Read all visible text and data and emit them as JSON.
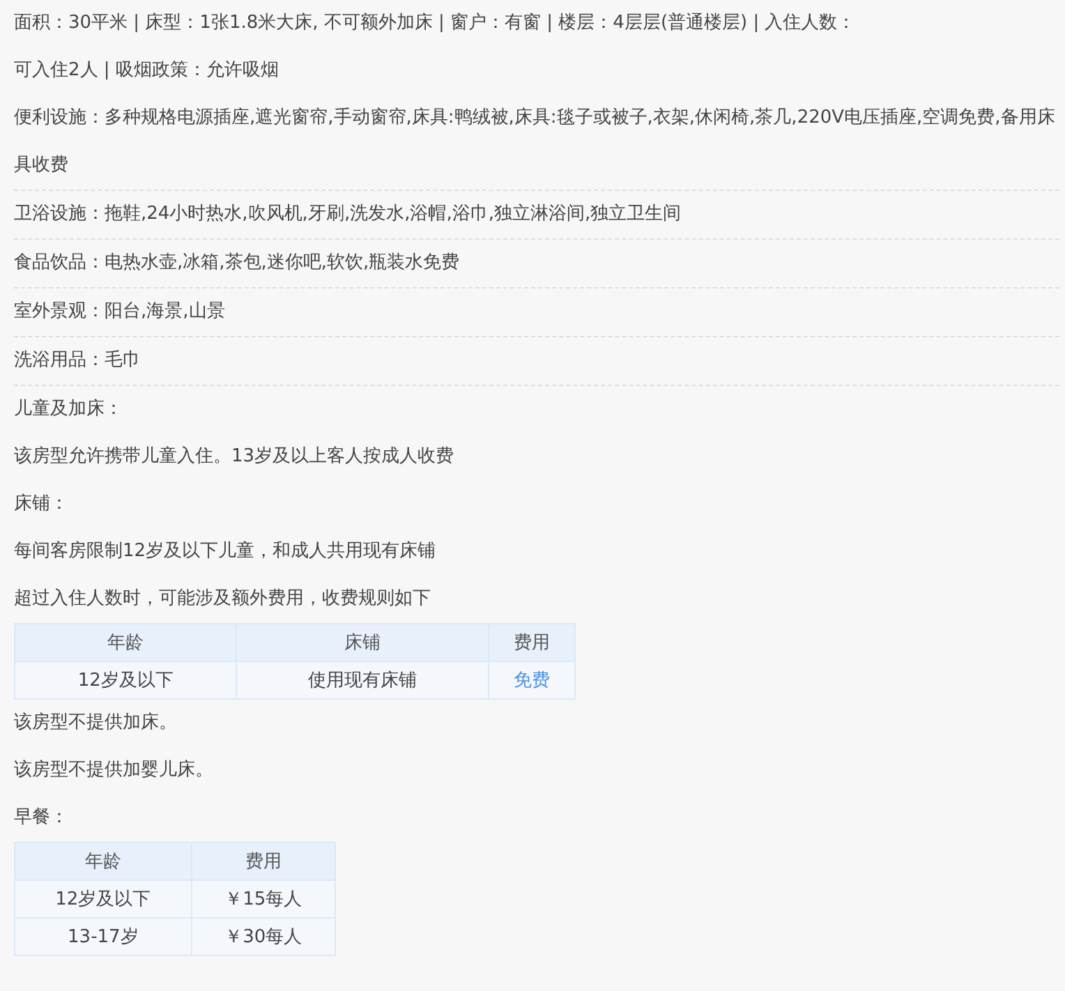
{
  "blocks": [
    {
      "kind": "text",
      "text": "面积：30平米 | 床型：1张1.8米大床, 不可额外加床 | 窗户：有窗 | 楼层：4层层(普通楼层) | 入住人数：",
      "divider": false
    },
    {
      "kind": "text",
      "text": "可入住2人 | 吸烟政策：允许吸烟",
      "divider": false
    },
    {
      "kind": "text",
      "text": "便利设施：多种规格电源插座,遮光窗帘,手动窗帘,床具:鸭绒被,床具:毯子或被子,衣架,休闲椅,茶几,220V电压插座,空调免费,备用床具收费",
      "divider": true
    },
    {
      "kind": "text",
      "text": "卫浴设施：拖鞋,24小时热水,吹风机,牙刷,洗发水,浴帽,浴巾,独立淋浴间,独立卫生间",
      "divider": true
    },
    {
      "kind": "text",
      "text": "食品饮品：电热水壶,冰箱,茶包,迷你吧,软饮,瓶装水免费",
      "divider": true
    },
    {
      "kind": "text",
      "text": "室外景观：阳台,海景,山景",
      "divider": true
    },
    {
      "kind": "text",
      "text": "洗浴用品：毛巾",
      "divider": true
    },
    {
      "kind": "text",
      "text": "儿童及加床：",
      "divider": false
    },
    {
      "kind": "text",
      "text": "该房型允许携带儿童入住。13岁及以上客人按成人收费",
      "divider": false
    },
    {
      "kind": "text",
      "text": "床铺：",
      "divider": false
    },
    {
      "kind": "text",
      "text": "每间客房限制12岁及以下儿童，和成人共用现有床铺",
      "divider": false
    },
    {
      "kind": "text",
      "text": "超过入住人数时，可能涉及额外费用，收费规则如下",
      "divider": false
    },
    {
      "kind": "table",
      "columns": [
        "年龄",
        "床铺",
        "费用"
      ],
      "rows": [
        {
          "cells": [
            "12岁及以下",
            "使用现有床铺",
            "免费"
          ],
          "highlight": [
            false,
            false,
            true
          ]
        }
      ]
    },
    {
      "kind": "text",
      "text": "该房型不提供加床。",
      "divider": false
    },
    {
      "kind": "text",
      "text": "该房型不提供加婴儿床。",
      "divider": false
    },
    {
      "kind": "text",
      "text": "早餐：",
      "divider": false
    },
    {
      "kind": "table",
      "columns": [
        "年龄",
        "费用"
      ],
      "rows": [
        {
          "cells": [
            "12岁及以下",
            "￥15每人"
          ],
          "highlight": [
            false,
            false
          ]
        },
        {
          "cells": [
            "13-17岁",
            "￥30每人"
          ],
          "highlight": [
            false,
            false
          ]
        }
      ]
    }
  ]
}
